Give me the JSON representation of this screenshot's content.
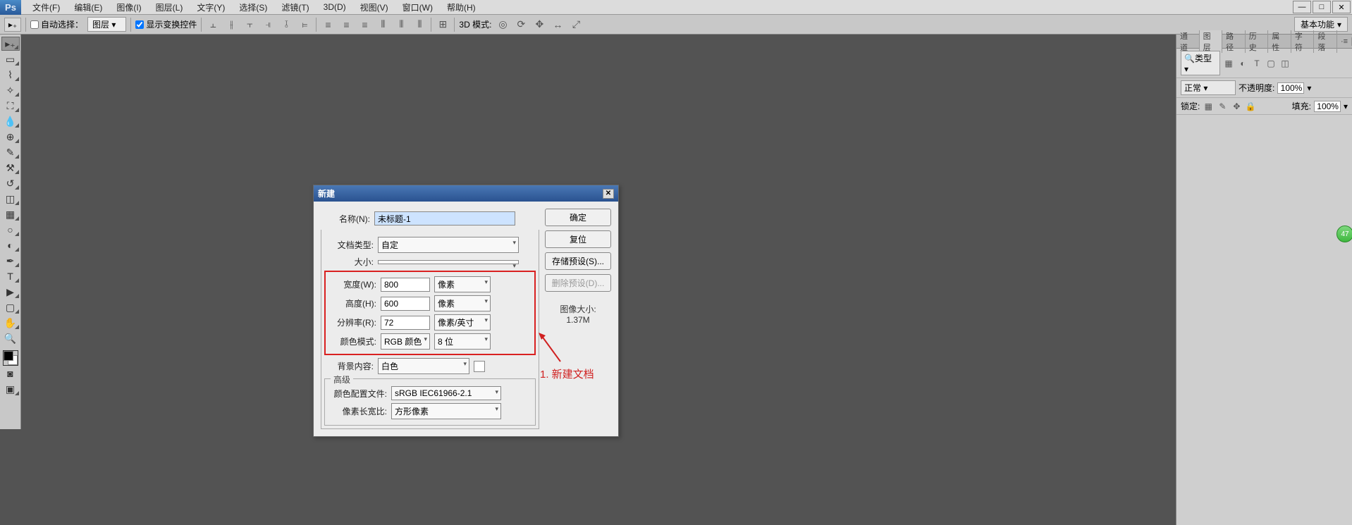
{
  "app": {
    "logo": "Ps"
  },
  "menu": {
    "items": [
      "文件(F)",
      "编辑(E)",
      "图像(I)",
      "图层(L)",
      "文字(Y)",
      "选择(S)",
      "滤镜(T)",
      "3D(D)",
      "视图(V)",
      "窗口(W)",
      "帮助(H)"
    ]
  },
  "options": {
    "auto_select": "自动选择：",
    "auto_select_target": "图层",
    "show_transform": "显示变换控件",
    "mode3d_label": "3D 模式:",
    "workspace": "基本功能"
  },
  "panels": {
    "tabs": [
      "通道",
      "图层",
      "路径",
      "历史",
      "属性",
      "字符",
      "段落"
    ],
    "kind_filter": "类型",
    "blend_mode": "正常",
    "opacity_label": "不透明度:",
    "opacity_value": "100%",
    "lock_label": "锁定:",
    "fill_label": "填充:",
    "fill_value": "100%"
  },
  "dialog": {
    "title": "新建",
    "name_label": "名称(N):",
    "name_value": "未标题-1",
    "preset_label": "文档类型:",
    "preset_value": "自定",
    "size_label": "大小:",
    "width_label": "宽度(W):",
    "width_value": "800",
    "width_unit": "像素",
    "height_label": "高度(H):",
    "height_value": "600",
    "height_unit": "像素",
    "res_label": "分辨率(R):",
    "res_value": "72",
    "res_unit": "像素/英寸",
    "cmode_label": "颜色模式:",
    "cmode_value": "RGB 颜色",
    "cdepth_value": "8 位",
    "bg_label": "背景内容:",
    "bg_value": "白色",
    "adv_label": "高级",
    "profile_label": "颜色配置文件:",
    "profile_value": "sRGB IEC61966-2.1",
    "aspect_label": "像素长宽比:",
    "aspect_value": "方形像素",
    "ok": "确定",
    "cancel": "复位",
    "save_preset": "存储预设(S)...",
    "delete_preset": "删除预设(D)...",
    "imgsize_label": "图像大小:",
    "imgsize_value": "1.37M"
  },
  "annotation": {
    "text": "1. 新建文档"
  },
  "badge": {
    "value": "47"
  },
  "winctl": {
    "min": "—",
    "max": "□",
    "close": "✕"
  }
}
